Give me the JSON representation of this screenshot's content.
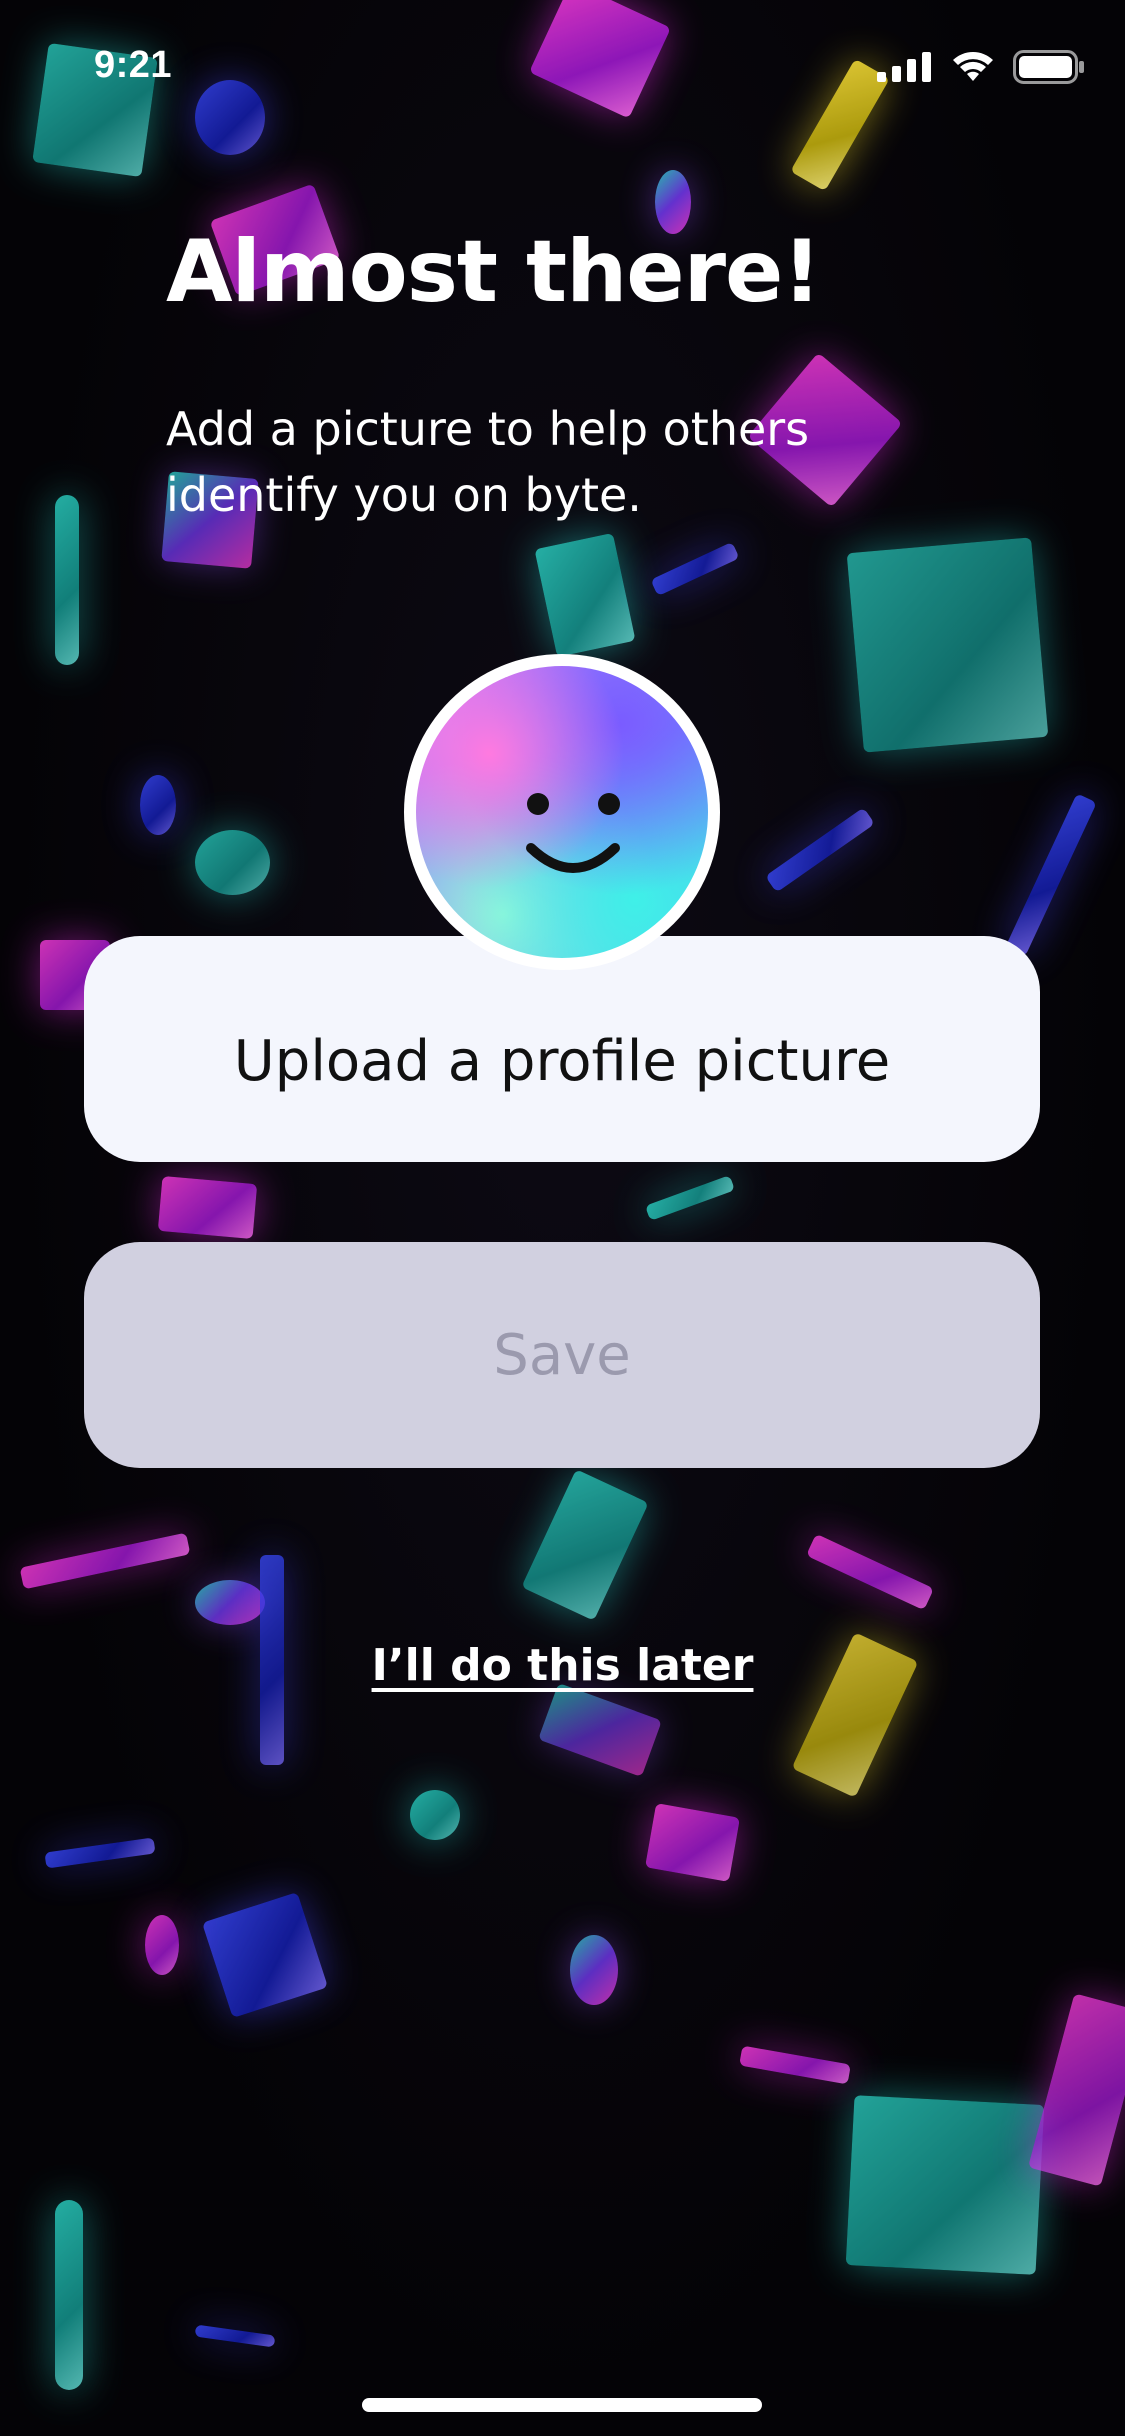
{
  "status_bar": {
    "time": "9:21",
    "icons": [
      "signal-icon",
      "wifi-icon",
      "battery-icon"
    ]
  },
  "content": {
    "title": "Almost there!",
    "subtitle": "Add a picture to help others identify you on byte.",
    "avatar_icon": "smiley-face-icon",
    "upload_label": "Upload a profile picture",
    "save_label": "Save",
    "skip_label": "I’ll do this later"
  },
  "colors": {
    "upload_button_bg": "#f4f6fd",
    "save_button_bg": "#d1d0e0",
    "save_button_text": "#9b9aae",
    "background": "#050307",
    "text_primary": "#ffffff"
  }
}
